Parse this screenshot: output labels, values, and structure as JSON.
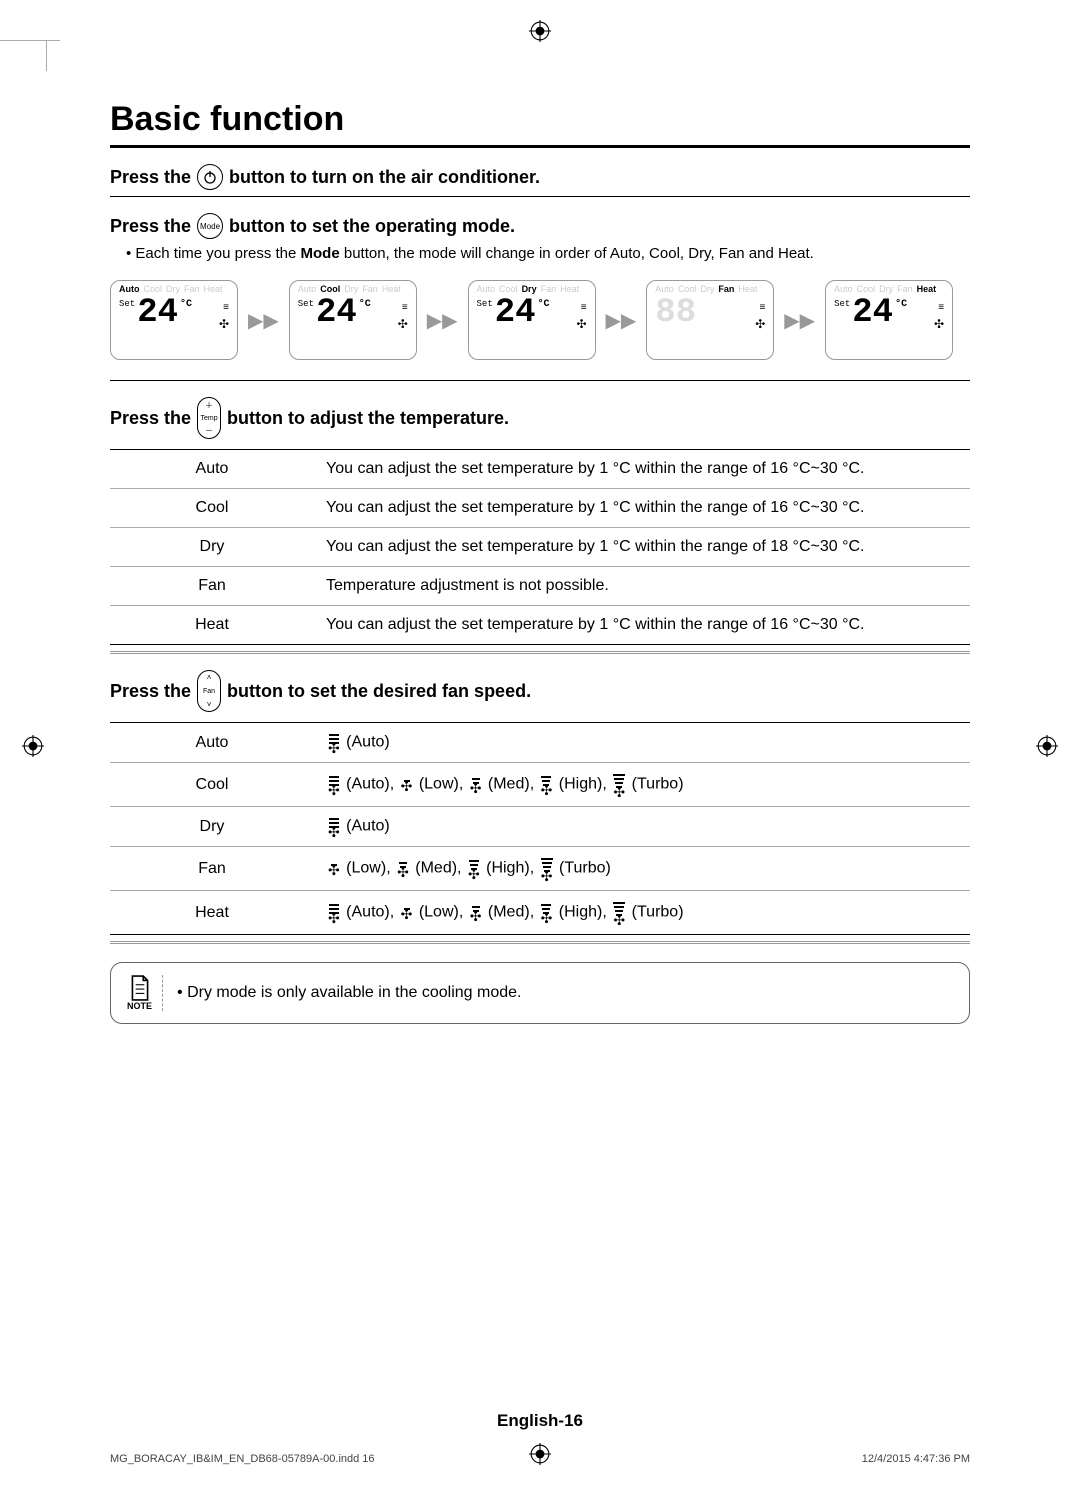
{
  "title": "Basic function",
  "step1": {
    "pre": "Press the",
    "post": "button to turn on the air conditioner."
  },
  "step2": {
    "pre": "Press the",
    "btn": "Mode",
    "post": "button to set the operating mode.",
    "bullet_a": "Each time you press the ",
    "bullet_b": "Mode",
    "bullet_c": " button, the mode will change in order of Auto, Cool, Dry, Fan and Heat."
  },
  "modes": {
    "labels": [
      "Auto",
      "Cool",
      "Dry",
      "Fan",
      "Heat"
    ],
    "display_value": "24",
    "unit": "°C",
    "set": "Set"
  },
  "step3": {
    "pre": "Press the",
    "btn_top": "＋",
    "btn_mid": "Temp",
    "btn_bot": "－",
    "post": "button to adjust the temperature."
  },
  "temp_table": [
    {
      "mode": "Auto",
      "desc": "You can adjust the set temperature by 1 °C within the range of 16 °C~30 °C."
    },
    {
      "mode": "Cool",
      "desc": "You can adjust the set temperature by 1 °C within the range of 16 °C~30 °C."
    },
    {
      "mode": "Dry",
      "desc": "You can adjust the set temperature by 1 °C within the range of 18 °C~30 °C."
    },
    {
      "mode": "Fan",
      "desc": "Temperature adjustment is not possible."
    },
    {
      "mode": "Heat",
      "desc": "You can adjust the set temperature by 1 °C within the range of 16 °C~30 °C."
    }
  ],
  "step4": {
    "pre": "Press the",
    "btn_top": "˄",
    "btn_mid": "Fan",
    "btn_bot": "˅",
    "post": "button to set the desired fan speed."
  },
  "fan_labels": {
    "auto": "(Auto)",
    "low": "(Low)",
    "med": "(Med)",
    "high": "(High)",
    "turbo": "(Turbo)"
  },
  "fan_table": [
    {
      "mode": "Auto",
      "speeds": [
        "auto"
      ]
    },
    {
      "mode": "Cool",
      "speeds": [
        "auto",
        "low",
        "med",
        "high",
        "turbo"
      ]
    },
    {
      "mode": "Dry",
      "speeds": [
        "auto"
      ]
    },
    {
      "mode": "Fan",
      "speeds": [
        "low",
        "med",
        "high",
        "turbo"
      ]
    },
    {
      "mode": "Heat",
      "speeds": [
        "auto",
        "low",
        "med",
        "high",
        "turbo"
      ]
    }
  ],
  "note": {
    "label": "NOTE",
    "text": "Dry mode is only available in the cooling mode."
  },
  "footer": "English-16",
  "print_left": "MG_BORACAY_IB&IM_EN_DB68-05789A-00.indd   16",
  "print_right": "12/4/2015   4:47:36 PM"
}
